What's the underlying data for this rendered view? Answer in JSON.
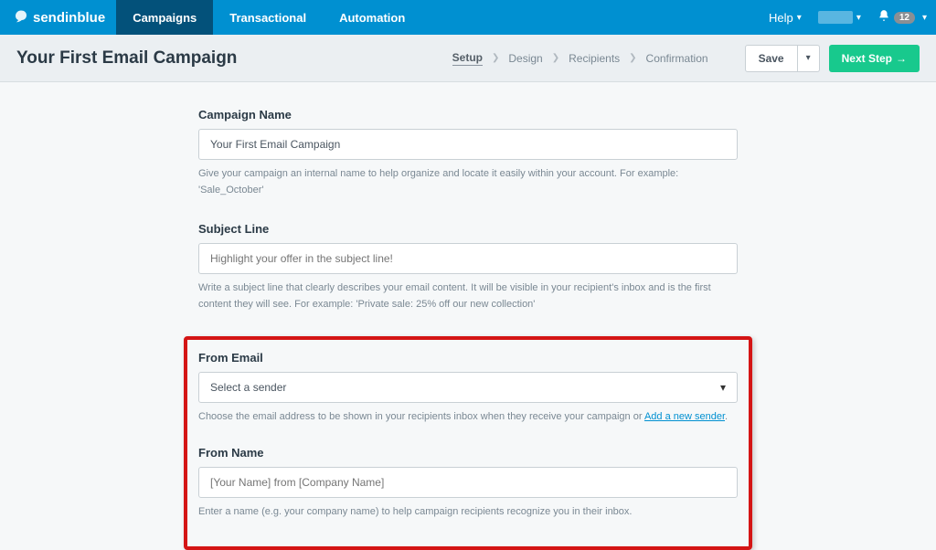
{
  "brand": "sendinblue",
  "nav": {
    "items": [
      {
        "label": "Campaigns",
        "active": true
      },
      {
        "label": "Transactional",
        "active": false
      },
      {
        "label": "Automation",
        "active": false
      }
    ],
    "help": "Help",
    "notification_count": "12"
  },
  "header": {
    "title": "Your First Email Campaign",
    "breadcrumb": [
      {
        "label": "Setup",
        "current": true
      },
      {
        "label": "Design",
        "current": false
      },
      {
        "label": "Recipients",
        "current": false
      },
      {
        "label": "Confirmation",
        "current": false
      }
    ],
    "save_label": "Save",
    "next_label": "Next Step"
  },
  "form": {
    "campaign_name": {
      "label": "Campaign Name",
      "value": "Your First Email Campaign",
      "hint": "Give your campaign an internal name to help organize and locate it easily within your account. For example: 'Sale_October'"
    },
    "subject_line": {
      "label": "Subject Line",
      "placeholder": "Highlight your offer in the subject line!",
      "hint": "Write a subject line that clearly describes your email content. It will be visible in your recipient's inbox and is the first content they will see. For example: 'Private sale: 25% off our new collection'"
    },
    "from_email": {
      "label": "From Email",
      "placeholder": "Select a sender",
      "hint_prefix": "Choose the email address to be shown in your recipients inbox when they receive your campaign or ",
      "hint_link": "Add a new sender",
      "hint_suffix": "."
    },
    "from_name": {
      "label": "From Name",
      "placeholder": "[Your Name] from [Company Name]",
      "hint": "Enter a name (e.g. your company name) to help campaign recipients recognize you in their inbox."
    }
  }
}
